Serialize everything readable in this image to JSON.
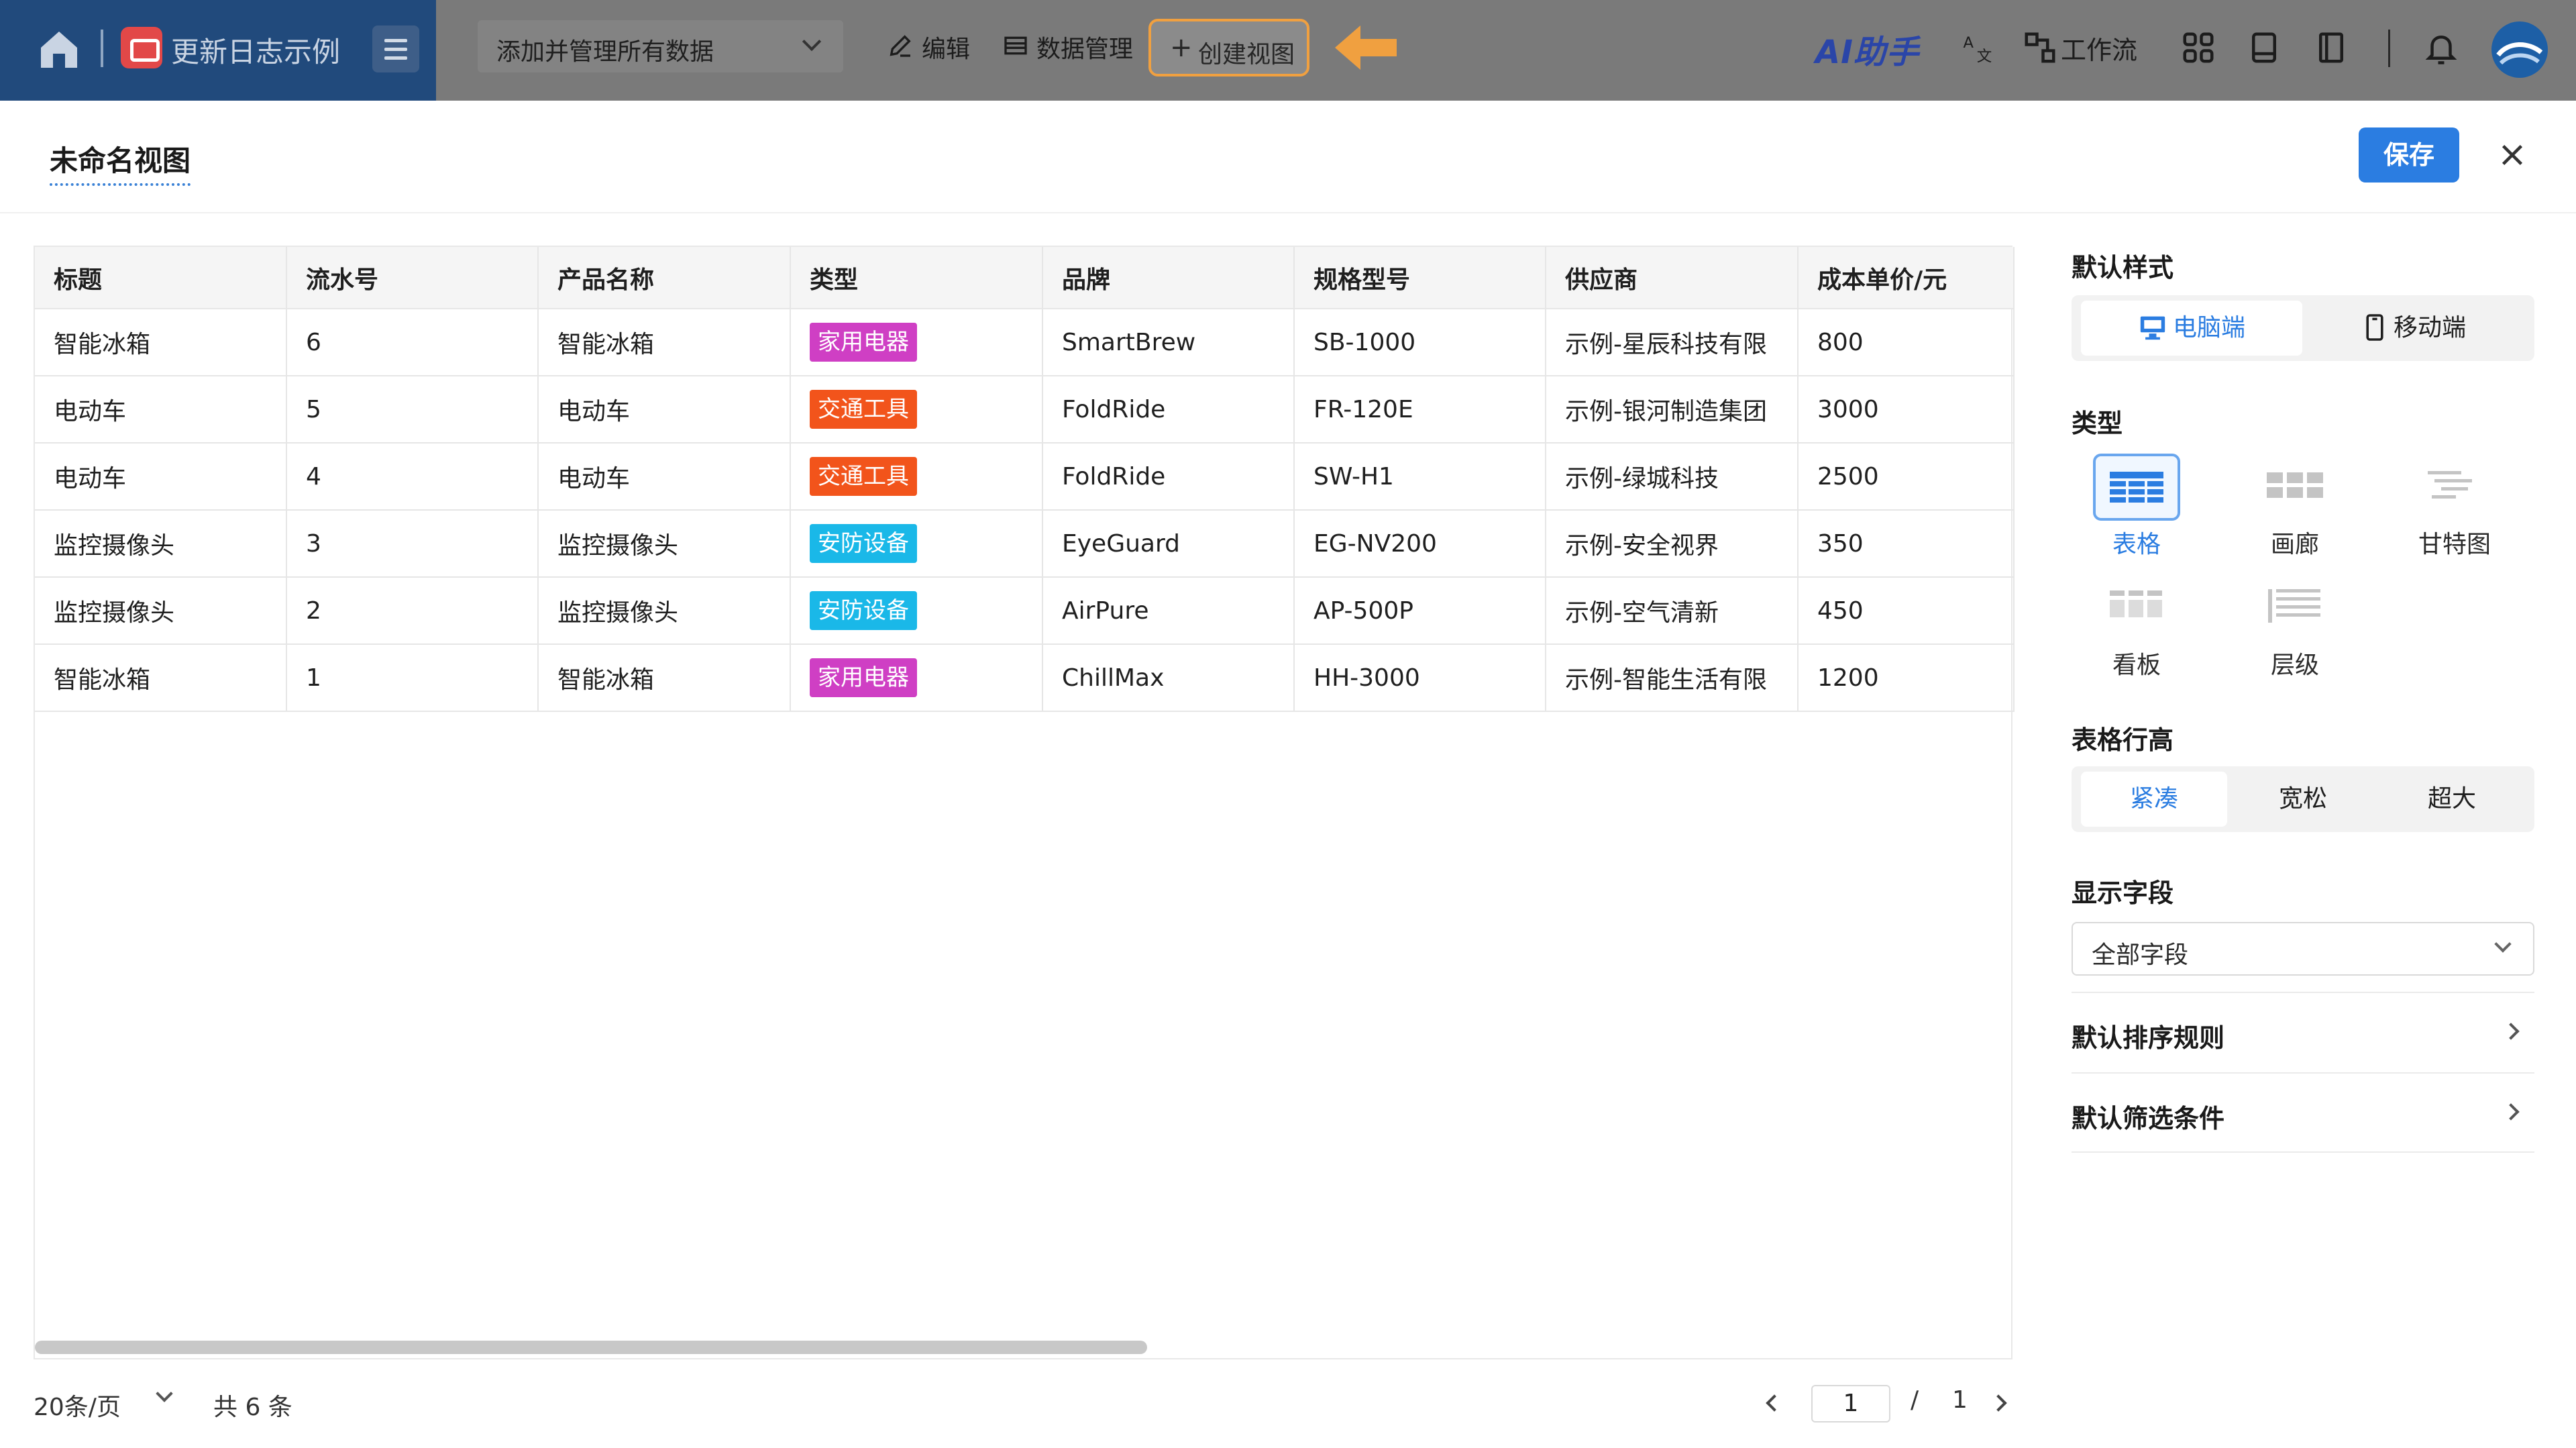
{
  "topbar": {
    "app_title": "更新日志示例",
    "data_select_value": "添加并管理所有数据",
    "edit_label": "编辑",
    "data_manage_label": "数据管理",
    "create_view_label": "创建视图",
    "ai_label": "AI助手",
    "workflow_label": "工作流"
  },
  "modal": {
    "view_name": "未命名视图",
    "save_label": "保存"
  },
  "table": {
    "columns": [
      "标题",
      "流水号",
      "产品名称",
      "类型",
      "品牌",
      "规格型号",
      "供应商",
      "成本单价/元"
    ],
    "rows": [
      {
        "title": "智能冰箱",
        "serial": "6",
        "product": "智能冰箱",
        "type": "家用电器",
        "type_color": "#cf3fc4",
        "brand": "SmartBrew",
        "model": "SB-1000",
        "supplier": "示例-星辰科技有限",
        "cost": "800"
      },
      {
        "title": "电动车",
        "serial": "5",
        "product": "电动车",
        "type": "交通工具",
        "type_color": "#f2541b",
        "brand": "FoldRide",
        "model": "FR-120E",
        "supplier": "示例-银河制造集团",
        "cost": "3000"
      },
      {
        "title": "电动车",
        "serial": "4",
        "product": "电动车",
        "type": "交通工具",
        "type_color": "#f2541b",
        "brand": "FoldRide",
        "model": "SW-H1",
        "supplier": "示例-绿城科技",
        "cost": "2500"
      },
      {
        "title": "监控摄像头",
        "serial": "3",
        "product": "监控摄像头",
        "type": "安防设备",
        "type_color": "#1ab8e8",
        "brand": "EyeGuard",
        "model": "EG-NV200",
        "supplier": "示例-安全视界",
        "cost": "350"
      },
      {
        "title": "监控摄像头",
        "serial": "2",
        "product": "监控摄像头",
        "type": "安防设备",
        "type_color": "#1ab8e8",
        "brand": "AirPure",
        "model": "AP-500P",
        "supplier": "示例-空气清新",
        "cost": "450"
      },
      {
        "title": "智能冰箱",
        "serial": "1",
        "product": "智能冰箱",
        "type": "家用电器",
        "type_color": "#cf3fc4",
        "brand": "ChillMax",
        "model": "HH-3000",
        "supplier": "示例-智能生活有限",
        "cost": "1200"
      }
    ]
  },
  "pager": {
    "page_size": "20条/页",
    "total": "共 6 条",
    "current": "1",
    "slash": "/",
    "pages": "1"
  },
  "panel": {
    "style_heading": "默认样式",
    "style_options": [
      "电脑端",
      "移动端"
    ],
    "type_heading": "类型",
    "types": [
      "表格",
      "画廊",
      "甘特图",
      "看板",
      "层级"
    ],
    "row_height_heading": "表格行高",
    "row_height_options": [
      "紧凑",
      "宽松",
      "超大"
    ],
    "fields_heading": "显示字段",
    "fields_value": "全部字段",
    "sort_label": "默认排序规则",
    "filter_label": "默认筛选条件"
  },
  "colors": {
    "brand_blue": "#214a7c",
    "accent": "#2b7de1",
    "callout_orange": "#f0a040"
  }
}
